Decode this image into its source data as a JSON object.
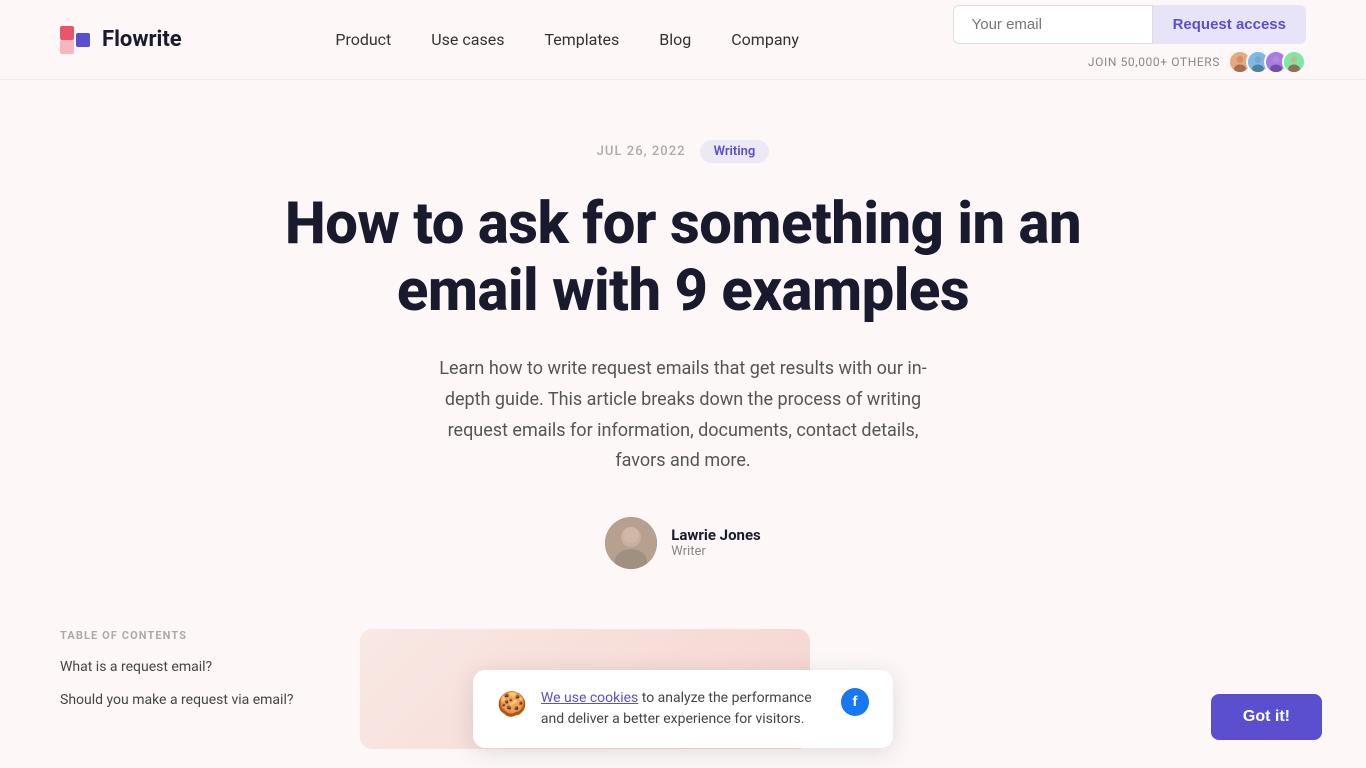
{
  "brand": {
    "name": "Flowrite",
    "logo_alt": "Flowrite logo"
  },
  "nav": {
    "links": [
      {
        "label": "Product",
        "id": "product"
      },
      {
        "label": "Use cases",
        "id": "use-cases"
      },
      {
        "label": "Templates",
        "id": "templates"
      },
      {
        "label": "Blog",
        "id": "blog"
      },
      {
        "label": "Company",
        "id": "company"
      }
    ],
    "email_placeholder": "Your email",
    "cta_label": "Request access",
    "join_text": "JOIN 50,000+ OTHERS"
  },
  "hero": {
    "date": "JUL 26, 2022",
    "category": "Writing",
    "title": "How to ask for something in an email with 9 examples",
    "subtitle": "Learn how to write request emails that get results with our in-depth guide. This article breaks down the process of writing request emails for information, documents, contact details, favors and more.",
    "author_name": "Lawrie Jones",
    "author_role": "Writer"
  },
  "toc": {
    "heading": "TABLE OF CONTENTS",
    "items": [
      {
        "label": "What is a request email?"
      },
      {
        "label": "Should you make a request via email?"
      }
    ]
  },
  "cookie": {
    "link_text": "We use cookies",
    "body_text": " to analyze the performance and deliver a better experience for visitors.",
    "got_it": "Got it!"
  },
  "colors": {
    "accent": "#5a4fcf",
    "badge_bg": "#ece9f5",
    "bg": "#fdf8f7",
    "btn_bg": "#e8e4f8"
  }
}
